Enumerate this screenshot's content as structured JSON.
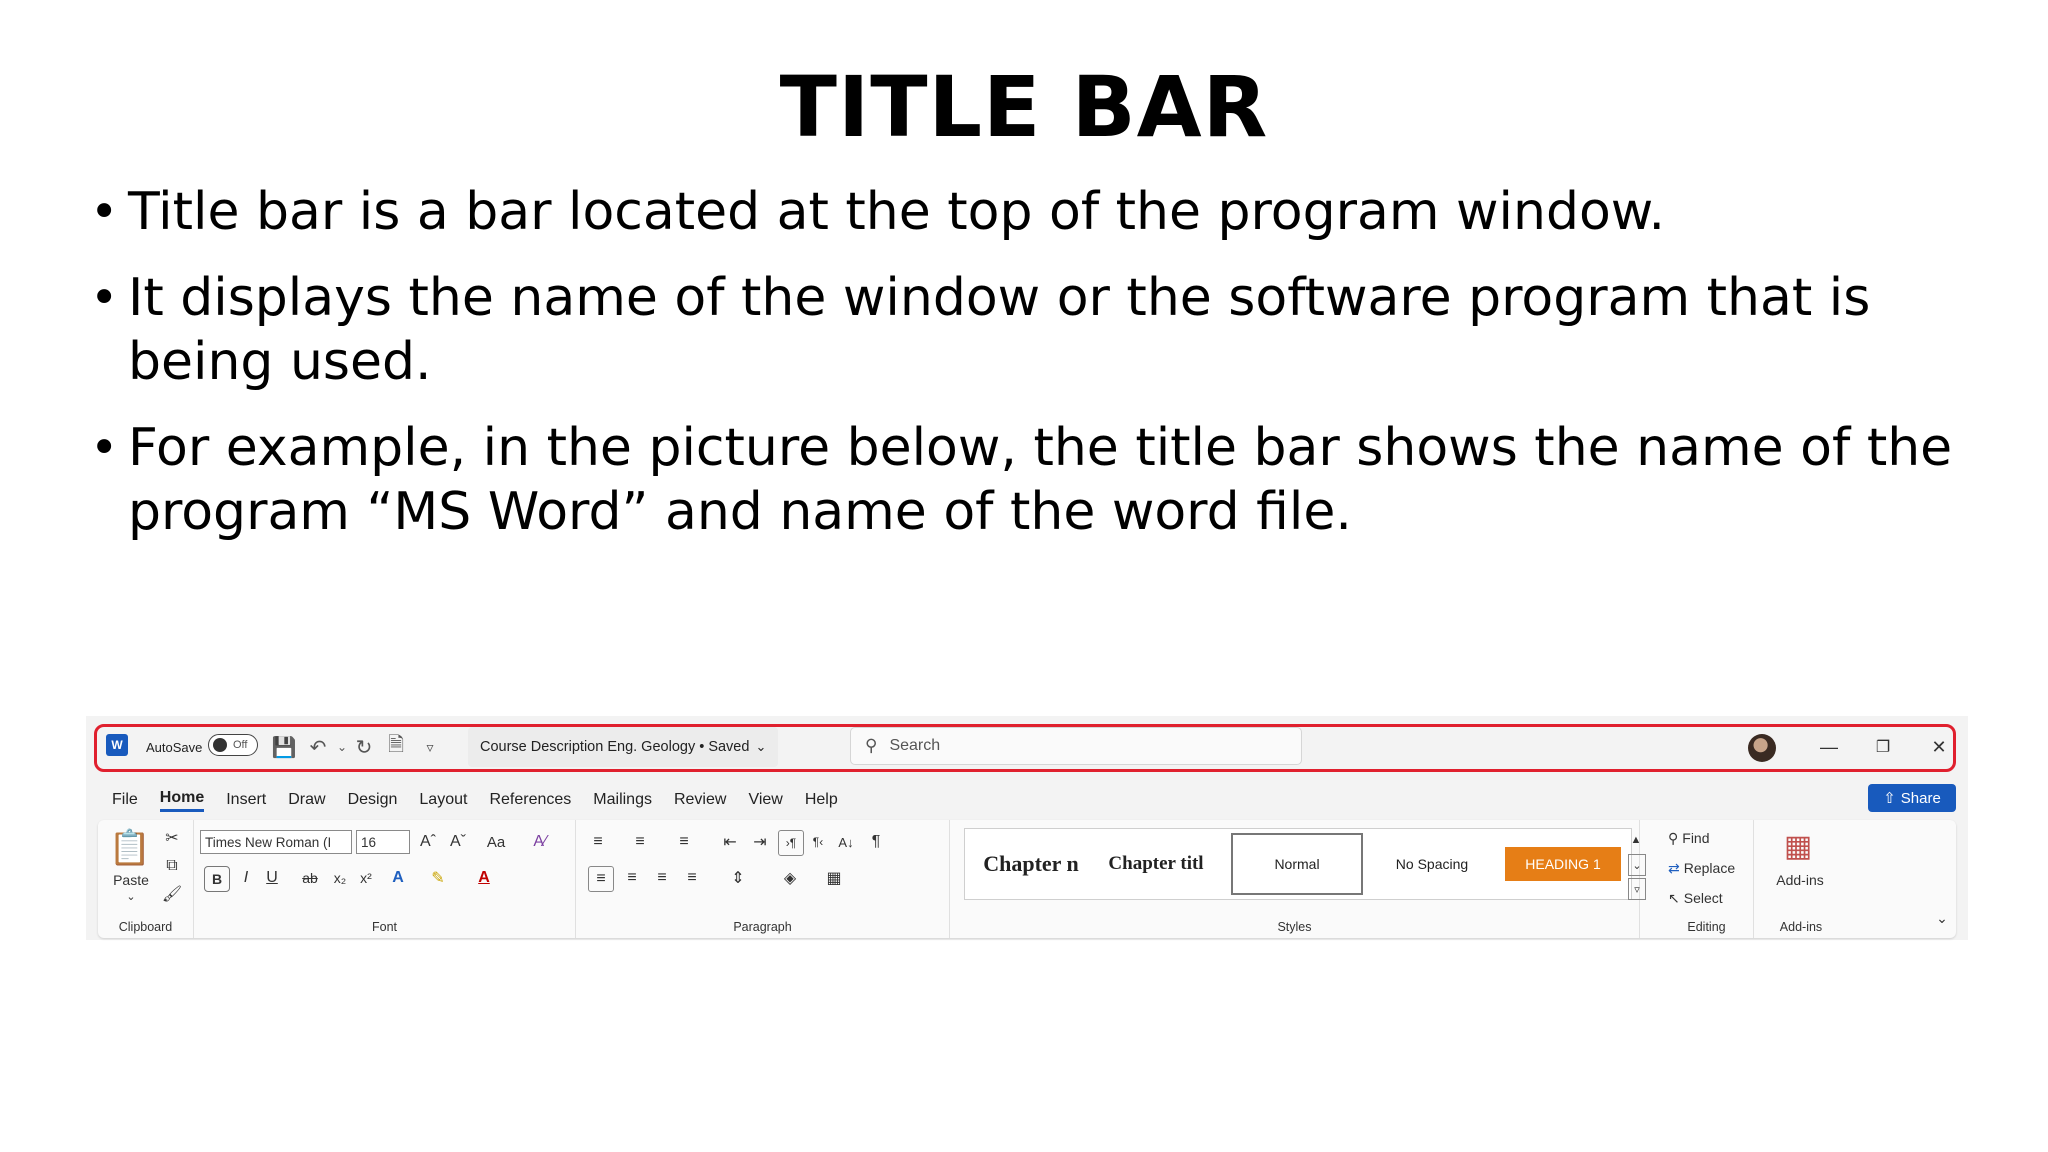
{
  "slide": {
    "title": "TITLE BAR",
    "bullets": [
      "Title bar is a bar located at the top of the program window.",
      "It displays the name of the window or the software program that is being used.",
      "For example, in the picture below, the title bar shows the name of the program “MS Word” and name of the word file."
    ]
  },
  "word": {
    "logo": "W",
    "autosave_label": "AutoSave",
    "autosave_state": "Off",
    "document_title": "Course Description Eng. Geology • Saved",
    "search_placeholder": "Search",
    "tabs": [
      "File",
      "Home",
      "Insert",
      "Draw",
      "Design",
      "Layout",
      "References",
      "Mailings",
      "Review",
      "View",
      "Help"
    ],
    "active_tab": "Home",
    "share_label": "Share",
    "clipboard": {
      "paste_label": "Paste",
      "group_label": "Clipboard"
    },
    "font": {
      "font_name": "Times New Roman (I",
      "font_size": "16",
      "change_case": "Aa",
      "group_label": "Font"
    },
    "paragraph": {
      "group_label": "Paragraph"
    },
    "styles": {
      "items": [
        "Chapter n",
        "Chapter titl",
        "Normal",
        "No Spacing",
        "HEADING 1"
      ],
      "group_label": "Styles"
    },
    "editing": {
      "find": "Find",
      "replace": "Replace",
      "select": "Select",
      "group_label": "Editing"
    },
    "addins": {
      "button": "Add-ins",
      "group_label": "Add-ins"
    },
    "colors": {
      "accent": "#185abd",
      "highlight_box": "#e0202e",
      "heading_style": "#e67e16"
    }
  }
}
